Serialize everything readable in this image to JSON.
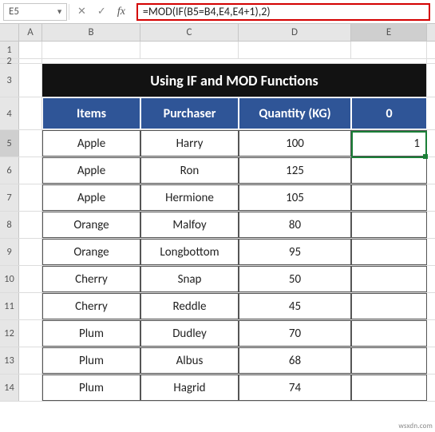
{
  "formula_bar": {
    "cell_ref": "E5",
    "formula": "=MOD(IF(B5=B4,E4,E4+1),2)"
  },
  "column_headers": [
    "A",
    "B",
    "C",
    "D",
    "E"
  ],
  "row_headers": [
    "1",
    "2",
    "3",
    "4",
    "5",
    "6",
    "7",
    "8",
    "9",
    "10",
    "11",
    "12",
    "13",
    "14"
  ],
  "title": "Using  IF and MOD Functions",
  "header": {
    "items": "Items",
    "purchaser": "Purchaser",
    "quantity": "Quantity (KG)",
    "helper": "0"
  },
  "rows": [
    {
      "items": "Apple",
      "purchaser": "Harry",
      "quantity": "100",
      "helper": "1"
    },
    {
      "items": "Apple",
      "purchaser": "Ron",
      "quantity": "125",
      "helper": ""
    },
    {
      "items": "Apple",
      "purchaser": "Hermione",
      "quantity": "105",
      "helper": ""
    },
    {
      "items": "Orange",
      "purchaser": "Malfoy",
      "quantity": "80",
      "helper": ""
    },
    {
      "items": "Orange",
      "purchaser": "Longbottom",
      "quantity": "95",
      "helper": ""
    },
    {
      "items": "Cherry",
      "purchaser": "Snap",
      "quantity": "50",
      "helper": ""
    },
    {
      "items": "Cherry",
      "purchaser": "Reddle",
      "quantity": "45",
      "helper": ""
    },
    {
      "items": "Plum",
      "purchaser": "Dudley",
      "quantity": "70",
      "helper": ""
    },
    {
      "items": "Plum",
      "purchaser": "Albus",
      "quantity": "68",
      "helper": ""
    },
    {
      "items": "Plum",
      "purchaser": "Hagrid",
      "quantity": "74",
      "helper": ""
    }
  ],
  "watermark": "wsxdn.com"
}
